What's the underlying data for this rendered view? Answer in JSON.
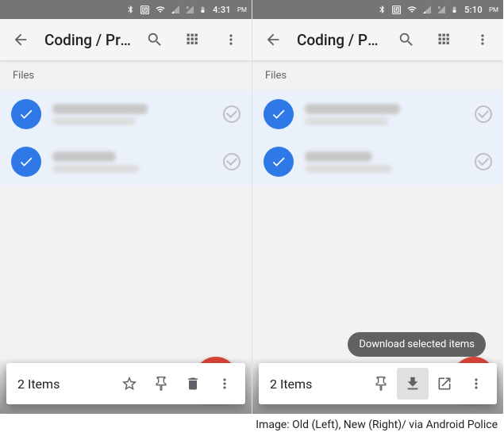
{
  "status": {
    "left_time": "4:31",
    "left_ampm": "PM",
    "right_time": "5:10",
    "right_ampm": "PM"
  },
  "left": {
    "title": "Coding / Progra…",
    "section": "Files",
    "selection_count": "2 Items"
  },
  "right": {
    "title": "Coding / Progra…",
    "section": "Files",
    "selection_count": "2 Items",
    "tooltip": "Download selected items"
  },
  "caption": "Image: Old (Left), New (Right)/ via Android Police"
}
